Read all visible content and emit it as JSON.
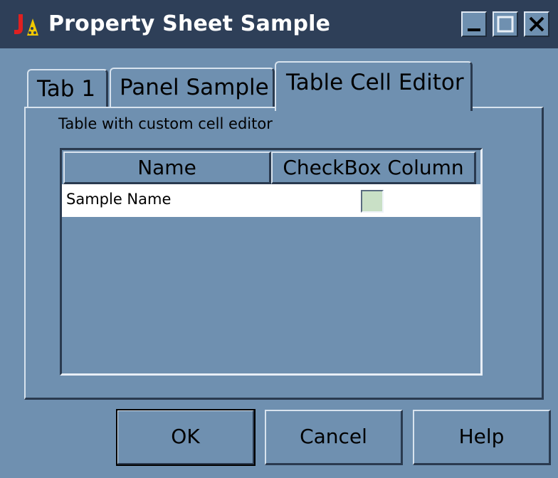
{
  "window": {
    "title": "Property Sheet Sample",
    "icon": "java-icon"
  },
  "tabs": [
    {
      "label": "Tab 1"
    },
    {
      "label": "Panel Sample"
    },
    {
      "label": "Table Cell Editor",
      "selected": true
    }
  ],
  "panel": {
    "label": "Table with custom cell editor",
    "table": {
      "columns": [
        "Name",
        "CheckBox Column"
      ],
      "rows": [
        {
          "name": "Sample Name",
          "checked": false
        }
      ]
    }
  },
  "buttons": {
    "ok": "OK",
    "cancel": "Cancel",
    "help": "Help"
  },
  "colors": {
    "titlebar": "#2e3f58",
    "background": "#6f90b0",
    "row": "#ffffff",
    "checkbox": "#c9e0c6"
  }
}
